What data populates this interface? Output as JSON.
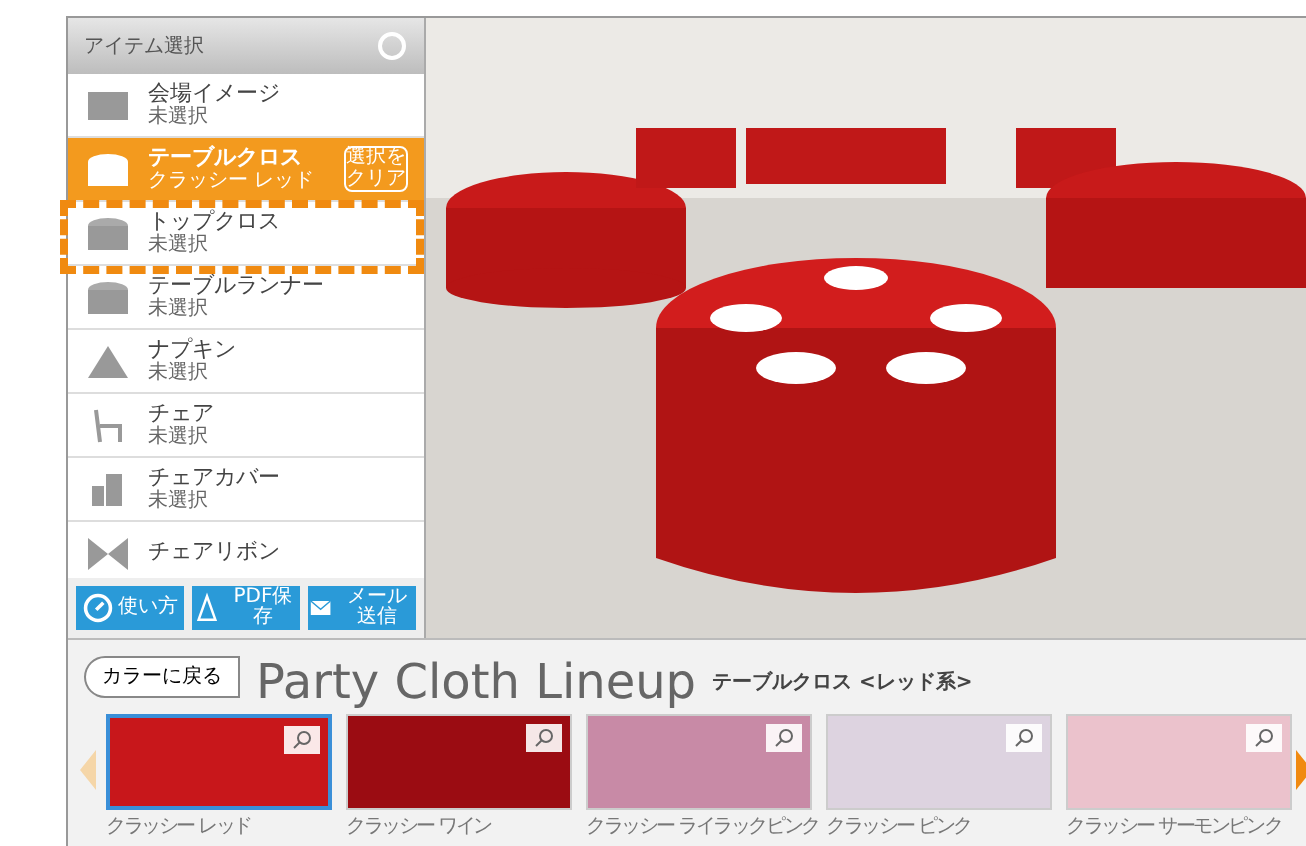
{
  "sidebar": {
    "title": "アイテム選択",
    "items": [
      {
        "label": "会場イメージ",
        "status": "未選択",
        "selected": false
      },
      {
        "label": "テーブルクロス",
        "status": "クラッシー レッド",
        "selected": true,
        "clear_button": "選択をクリア"
      },
      {
        "label": "トップクロス",
        "status": "未選択",
        "selected": false
      },
      {
        "label": "テーブルランナー",
        "status": "未選択",
        "selected": false
      },
      {
        "label": "ナプキン",
        "status": "未選択",
        "selected": false
      },
      {
        "label": "チェア",
        "status": "未選択",
        "selected": false
      },
      {
        "label": "チェアカバー",
        "status": "未選択",
        "selected": false
      },
      {
        "label": "チェアリボン",
        "selected": false
      }
    ],
    "buttons": [
      {
        "label": "使い方"
      },
      {
        "label": "PDF保存"
      },
      {
        "label": "メール送信"
      }
    ]
  },
  "lineup": {
    "back_button": "カラーに戻る",
    "title": "Party Cloth Lineup",
    "subtitle": "テーブルクロス <レッド系>",
    "swatches": [
      {
        "label": "クラッシー レッド",
        "color": "#c8171b",
        "selected": true
      },
      {
        "label": "クラッシー ワイン",
        "color": "#9b0c12",
        "selected": false
      },
      {
        "label": "クラッシー ライラックピンク",
        "color": "#c88aa6",
        "selected": false
      },
      {
        "label": "クラッシー ピンク",
        "color": "#ddd3e0",
        "selected": false
      },
      {
        "label": "クラッシー サーモンピンク",
        "color": "#ebc2cc",
        "selected": false
      }
    ]
  }
}
